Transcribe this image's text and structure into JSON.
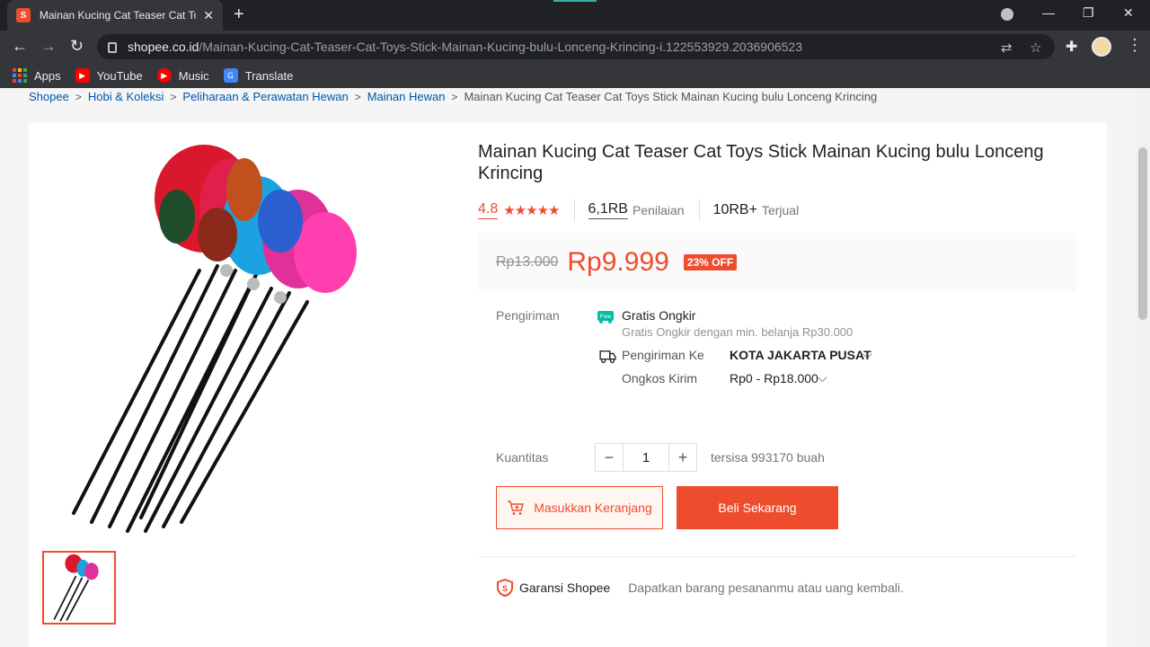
{
  "browser": {
    "tab_title": "Mainan Kucing Cat Teaser Cat Toys Stick Mainan Kucing bulu Lonceng Kricing | Shopee Indonesia",
    "url_host": "shopee.co.id",
    "url_path": "/Mainan-Kucing-Cat-Teaser-Cat-Toys-Stick-Mainan-Kucing-bulu-Lonceng-Krincing-i.122553929.2036906523",
    "bookmarks": [
      {
        "label": "Apps",
        "icon": "apps-grid-icon"
      },
      {
        "label": "YouTube",
        "icon": "youtube-icon"
      },
      {
        "label": "Music",
        "icon": "youtube-music-icon"
      },
      {
        "label": "Translate",
        "icon": "google-translate-icon"
      }
    ]
  },
  "breadcrumb": [
    "Shopee",
    "Hobi & Koleksi",
    "Peliharaan & Perawatan Hewan",
    "Mainan Hewan"
  ],
  "breadcrumb_current": "Mainan Kucing Cat Teaser Cat Toys Stick Mainan Kucing bulu Lonceng Krincing",
  "product": {
    "title": "Mainan Kucing Cat Teaser Cat Toys Stick Mainan Kucing bulu Lonceng Krincing",
    "rating": "4.8",
    "stars": "★★★★★",
    "reviews_count": "6,1RB",
    "reviews_label": "Penilaian",
    "sold_count": "10RB+",
    "sold_label": "Terjual",
    "old_price": "Rp13.000",
    "price": "Rp9.999",
    "discount": "23% OFF"
  },
  "shipping": {
    "label": "Pengiriman",
    "free_badge": "Free",
    "free_title": "Gratis Ongkir",
    "free_sub": "Gratis Ongkir dengan min. belanja Rp30.000",
    "to_label": "Pengiriman Ke",
    "to_value": "KOTA JAKARTA PUSAT",
    "cost_label": "Ongkos Kirim",
    "cost_value": "Rp0 - Rp18.000"
  },
  "quantity": {
    "label": "Kuantitas",
    "value": "1",
    "stock": "tersisa 993170 buah"
  },
  "actions": {
    "cart": "Masukkan Keranjang",
    "buy": "Beli Sekarang"
  },
  "guarantee": {
    "title": "Garansi Shopee",
    "desc": "Dapatkan barang pesananmu atau uang kembali."
  },
  "colors": {
    "brand": "#ee4d2d",
    "link": "#0055aa"
  }
}
